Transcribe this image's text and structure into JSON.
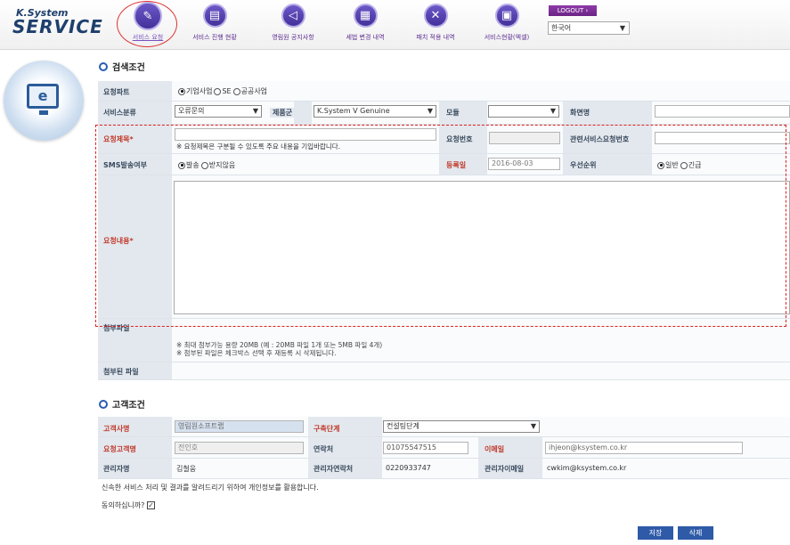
{
  "logo": {
    "line1": "K.System",
    "line2": "SERVICE"
  },
  "nav": [
    {
      "label": "서비스 요청",
      "icon": "pencil-icon"
    },
    {
      "label": "서비스 진행 현황",
      "icon": "document-icon"
    },
    {
      "label": "영림원 공지사항",
      "icon": "speaker-icon"
    },
    {
      "label": "세법 변경 내역",
      "icon": "calculator-icon"
    },
    {
      "label": "패치 적용 내역",
      "icon": "tools-icon"
    },
    {
      "label": "서비스현황(엑셀)",
      "icon": "spreadsheet-icon"
    }
  ],
  "logout": "LOGOUT ›",
  "language": "한국어",
  "search": {
    "title": "검색조건",
    "part_label": "요청파트",
    "part_options": [
      "기업사업",
      "SE",
      "공공사업"
    ],
    "service_type_label": "서비스분류",
    "service_type_value": "오류문의",
    "product_label": "제품군",
    "product_value": "K.System V Genuine",
    "module_label": "모듈",
    "module_value": "",
    "screen_label": "화면명",
    "subject_label": "요청제목*",
    "subject_hint": "※ 요청제목은 구분될 수 있도록 주요 내용을 기입바랍니다.",
    "request_no_label": "요청번호",
    "related_no_label": "관련서비스요청번호",
    "sms_label": "SMS발송여부",
    "sms_options": [
      "발송",
      "받지않음"
    ],
    "reg_date_label": "등록일",
    "reg_date_value": "2016-08-03",
    "priority_label": "우선순위",
    "priority_options": [
      "일반",
      "긴급"
    ],
    "content_label": "요청내용*",
    "attach_label": "첨부파일",
    "attach_note1": "※ 최대 첨부가능 용량 20MB (예 : 20MB 파일 1개 또는 5MB 파일 4개)",
    "attach_note2": "※ 첨부된 파일은 체크박스 선택 후 재등록 시 삭제됩니다.",
    "attached_label": "첨부된 파일"
  },
  "customer": {
    "title": "고객조건",
    "company_label": "고객사명",
    "company_value": "영림원소프트랩",
    "stage_label": "구축단계",
    "stage_value": "컨설팅단계",
    "requester_label": "요청고객명",
    "requester_value": "전인호",
    "contact_label": "연락처",
    "contact_value": "01075547515",
    "email_label": "이메일",
    "email_value": "ihjeon@ksystem.co.kr",
    "manager_label": "관리자명",
    "manager_value": "김철웅",
    "manager_phone_label": "관리자연락처",
    "manager_phone_value": "0220933747",
    "manager_email_label": "관리자이메일",
    "manager_email_value": "cwkim@ksystem.co.kr"
  },
  "consent_text": "신속한 서비스 처리 및 결과를 알려드리기 위하여 개인정보를 활용합니다.",
  "consent_question": "동의하십니까?",
  "buttons": {
    "save": "저장",
    "delete": "삭제"
  }
}
